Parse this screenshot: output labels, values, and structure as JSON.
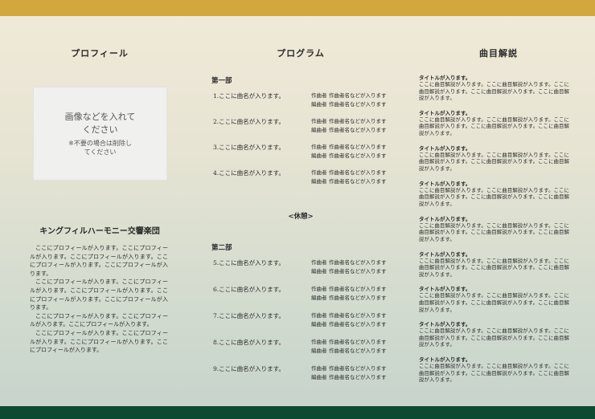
{
  "colors": {
    "top_band": "#d2a73e",
    "bottom_band": "#0d4a32"
  },
  "profile": {
    "heading": "プロフィール",
    "photo_main": "画像などを入れてください",
    "photo_note": "※不要の場合は削除してください",
    "orchestra_name": "キングフィルハーモニー交響楽団",
    "paragraphs": [
      "ここにプロフィールが入ります。ここにプロフィールが入ります。ここにプロフィールが入ります。ここにプロフィールが入ります。ここにプロフィールが入ります。",
      "ここにプロフィールが入ります。ここにプロフィールが入ります。ここにプロフィールが入ります。ここにプロフィールが入ります。ここにプロフィールが入ります。",
      "ここにプロフィールが入ります。ここにプロフィールが入ります。ここにプロフィールが入ります。",
      "ここにプロフィールが入ります。ここにプロフィールが入ります。ここにプロフィールが入ります。ここにプロフィールが入ります。"
    ]
  },
  "program": {
    "heading": "プログラム",
    "part1_title": "第一部",
    "part2_title": "第二部",
    "break_label": "<休憩>",
    "composer_role": "作曲者",
    "arranger_role": "編曲者",
    "credit_text": "作曲者名などが入ります",
    "part1": [
      {
        "label": "1.ここに曲名が入ります。"
      },
      {
        "label": "2.ここに曲名が入ります。"
      },
      {
        "label": "3.ここに曲名が入ります。"
      },
      {
        "label": "4.ここに曲名が入ります。"
      }
    ],
    "part2": [
      {
        "label": "5.ここに曲名が入ります。"
      },
      {
        "label": "6.ここに曲名が入ります。"
      },
      {
        "label": "7.ここに曲名が入ります。"
      },
      {
        "label": "8.ここに曲名が入ります。"
      },
      {
        "label": "9.ここに曲名が入ります。"
      }
    ]
  },
  "notes": {
    "heading": "曲目解説",
    "items": [
      {
        "title": "タイトルが入ります。",
        "body": "ここに曲目解説が入ります。ここに曲目解説が入ります。ここに曲目解説が入ります。ここに曲目解説が入ります。ここに曲目解説が入ります。"
      },
      {
        "title": "タイトルが入ります。",
        "body": "ここに曲目解説が入ります。ここに曲目解説が入ります。ここに曲目解説が入ります。ここに曲目解説が入ります。ここに曲目解説が入ります。"
      },
      {
        "title": "タイトルが入ります。",
        "body": "ここに曲目解説が入ります。ここに曲目解説が入ります。ここに曲目解説が入ります。ここに曲目解説が入ります。ここに曲目解説が入ります。"
      },
      {
        "title": "タイトルが入ります。",
        "body": "ここに曲目解説が入ります。ここに曲目解説が入ります。ここに曲目解説が入ります。ここに曲目解説が入ります。ここに曲目解説が入ります。"
      },
      {
        "title": "タイトルが入ります。",
        "body": "ここに曲目解説が入ります。ここに曲目解説が入ります。ここに曲目解説が入ります。ここに曲目解説が入ります。ここに曲目解説が入ります。"
      },
      {
        "title": "タイトルが入ります。",
        "body": "ここに曲目解説が入ります。ここに曲目解説が入ります。ここに曲目解説が入ります。ここに曲目解説が入ります。ここに曲目解説が入ります。"
      },
      {
        "title": "タイトルが入ります。",
        "body": "ここに曲目解説が入ります。ここに曲目解説が入ります。ここに曲目解説が入ります。ここに曲目解説が入ります。ここに曲目解説が入ります。"
      },
      {
        "title": "タイトルが入ります。",
        "body": "ここに曲目解説が入ります。ここに曲目解説が入ります。ここに曲目解説が入ります。ここに曲目解説が入ります。ここに曲目解説が入ります。"
      },
      {
        "title": "タイトルが入ります。",
        "body": "ここに曲目解説が入ります。ここに曲目解説が入ります。ここに曲目解説が入ります。ここに曲目解説が入ります。ここに曲目解説が入ります。"
      }
    ]
  }
}
